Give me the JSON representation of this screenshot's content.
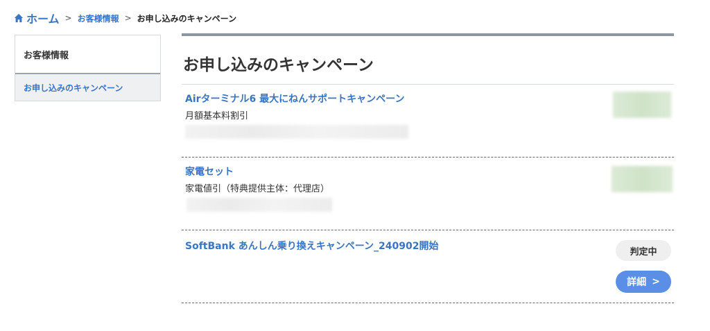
{
  "breadcrumb": {
    "home": "ホーム",
    "separator": ">",
    "customer_info": "お客様情報",
    "current": "お申し込みのキャンペーン"
  },
  "sidebar": {
    "title": "お客様情報",
    "items": [
      {
        "label": "お申し込みのキャンペーン"
      }
    ]
  },
  "main": {
    "title": "お申し込みのキャンペーン",
    "campaigns": [
      {
        "title": "Airターミナル6 最大にねんサポートキャンペーン",
        "description": "月額基本料割引"
      },
      {
        "title": "家電セット",
        "description": "家電値引（特典提供主体：代理店）"
      },
      {
        "title": "SoftBank あんしん乗り換えキャンペーン_240902開始",
        "status": "判定中",
        "details_label": "詳細",
        "details_chevron": ">"
      }
    ]
  },
  "colors": {
    "accent": "#3a74c4",
    "button": "#5b8ee6",
    "status_bg": "#efefef"
  },
  "icons": {
    "home": "home-icon"
  }
}
